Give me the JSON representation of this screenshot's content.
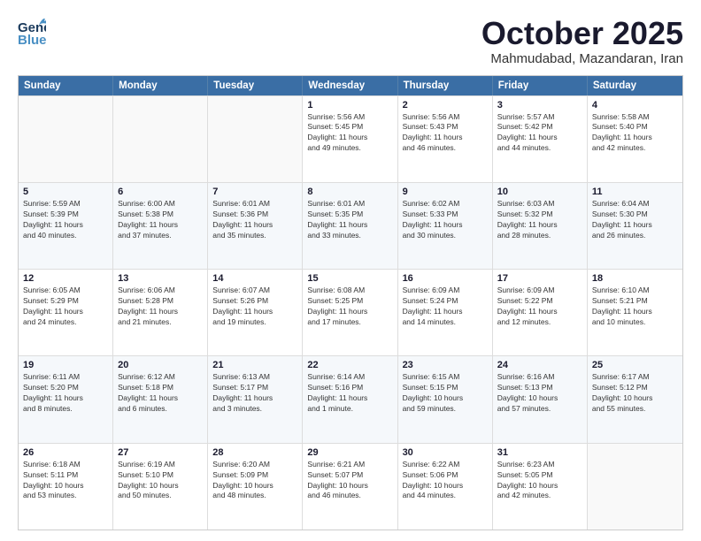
{
  "header": {
    "logo_general": "General",
    "logo_blue": "Blue",
    "month_title": "October 2025",
    "location": "Mahmudabad, Mazandaran, Iran"
  },
  "days_of_week": [
    "Sunday",
    "Monday",
    "Tuesday",
    "Wednesday",
    "Thursday",
    "Friday",
    "Saturday"
  ],
  "rows": [
    [
      {
        "day": "",
        "lines": []
      },
      {
        "day": "",
        "lines": []
      },
      {
        "day": "",
        "lines": []
      },
      {
        "day": "1",
        "lines": [
          "Sunrise: 5:56 AM",
          "Sunset: 5:45 PM",
          "Daylight: 11 hours",
          "and 49 minutes."
        ]
      },
      {
        "day": "2",
        "lines": [
          "Sunrise: 5:56 AM",
          "Sunset: 5:43 PM",
          "Daylight: 11 hours",
          "and 46 minutes."
        ]
      },
      {
        "day": "3",
        "lines": [
          "Sunrise: 5:57 AM",
          "Sunset: 5:42 PM",
          "Daylight: 11 hours",
          "and 44 minutes."
        ]
      },
      {
        "day": "4",
        "lines": [
          "Sunrise: 5:58 AM",
          "Sunset: 5:40 PM",
          "Daylight: 11 hours",
          "and 42 minutes."
        ]
      }
    ],
    [
      {
        "day": "5",
        "lines": [
          "Sunrise: 5:59 AM",
          "Sunset: 5:39 PM",
          "Daylight: 11 hours",
          "and 40 minutes."
        ]
      },
      {
        "day": "6",
        "lines": [
          "Sunrise: 6:00 AM",
          "Sunset: 5:38 PM",
          "Daylight: 11 hours",
          "and 37 minutes."
        ]
      },
      {
        "day": "7",
        "lines": [
          "Sunrise: 6:01 AM",
          "Sunset: 5:36 PM",
          "Daylight: 11 hours",
          "and 35 minutes."
        ]
      },
      {
        "day": "8",
        "lines": [
          "Sunrise: 6:01 AM",
          "Sunset: 5:35 PM",
          "Daylight: 11 hours",
          "and 33 minutes."
        ]
      },
      {
        "day": "9",
        "lines": [
          "Sunrise: 6:02 AM",
          "Sunset: 5:33 PM",
          "Daylight: 11 hours",
          "and 30 minutes."
        ]
      },
      {
        "day": "10",
        "lines": [
          "Sunrise: 6:03 AM",
          "Sunset: 5:32 PM",
          "Daylight: 11 hours",
          "and 28 minutes."
        ]
      },
      {
        "day": "11",
        "lines": [
          "Sunrise: 6:04 AM",
          "Sunset: 5:30 PM",
          "Daylight: 11 hours",
          "and 26 minutes."
        ]
      }
    ],
    [
      {
        "day": "12",
        "lines": [
          "Sunrise: 6:05 AM",
          "Sunset: 5:29 PM",
          "Daylight: 11 hours",
          "and 24 minutes."
        ]
      },
      {
        "day": "13",
        "lines": [
          "Sunrise: 6:06 AM",
          "Sunset: 5:28 PM",
          "Daylight: 11 hours",
          "and 21 minutes."
        ]
      },
      {
        "day": "14",
        "lines": [
          "Sunrise: 6:07 AM",
          "Sunset: 5:26 PM",
          "Daylight: 11 hours",
          "and 19 minutes."
        ]
      },
      {
        "day": "15",
        "lines": [
          "Sunrise: 6:08 AM",
          "Sunset: 5:25 PM",
          "Daylight: 11 hours",
          "and 17 minutes."
        ]
      },
      {
        "day": "16",
        "lines": [
          "Sunrise: 6:09 AM",
          "Sunset: 5:24 PM",
          "Daylight: 11 hours",
          "and 14 minutes."
        ]
      },
      {
        "day": "17",
        "lines": [
          "Sunrise: 6:09 AM",
          "Sunset: 5:22 PM",
          "Daylight: 11 hours",
          "and 12 minutes."
        ]
      },
      {
        "day": "18",
        "lines": [
          "Sunrise: 6:10 AM",
          "Sunset: 5:21 PM",
          "Daylight: 11 hours",
          "and 10 minutes."
        ]
      }
    ],
    [
      {
        "day": "19",
        "lines": [
          "Sunrise: 6:11 AM",
          "Sunset: 5:20 PM",
          "Daylight: 11 hours",
          "and 8 minutes."
        ]
      },
      {
        "day": "20",
        "lines": [
          "Sunrise: 6:12 AM",
          "Sunset: 5:18 PM",
          "Daylight: 11 hours",
          "and 6 minutes."
        ]
      },
      {
        "day": "21",
        "lines": [
          "Sunrise: 6:13 AM",
          "Sunset: 5:17 PM",
          "Daylight: 11 hours",
          "and 3 minutes."
        ]
      },
      {
        "day": "22",
        "lines": [
          "Sunrise: 6:14 AM",
          "Sunset: 5:16 PM",
          "Daylight: 11 hours",
          "and 1 minute."
        ]
      },
      {
        "day": "23",
        "lines": [
          "Sunrise: 6:15 AM",
          "Sunset: 5:15 PM",
          "Daylight: 10 hours",
          "and 59 minutes."
        ]
      },
      {
        "day": "24",
        "lines": [
          "Sunrise: 6:16 AM",
          "Sunset: 5:13 PM",
          "Daylight: 10 hours",
          "and 57 minutes."
        ]
      },
      {
        "day": "25",
        "lines": [
          "Sunrise: 6:17 AM",
          "Sunset: 5:12 PM",
          "Daylight: 10 hours",
          "and 55 minutes."
        ]
      }
    ],
    [
      {
        "day": "26",
        "lines": [
          "Sunrise: 6:18 AM",
          "Sunset: 5:11 PM",
          "Daylight: 10 hours",
          "and 53 minutes."
        ]
      },
      {
        "day": "27",
        "lines": [
          "Sunrise: 6:19 AM",
          "Sunset: 5:10 PM",
          "Daylight: 10 hours",
          "and 50 minutes."
        ]
      },
      {
        "day": "28",
        "lines": [
          "Sunrise: 6:20 AM",
          "Sunset: 5:09 PM",
          "Daylight: 10 hours",
          "and 48 minutes."
        ]
      },
      {
        "day": "29",
        "lines": [
          "Sunrise: 6:21 AM",
          "Sunset: 5:07 PM",
          "Daylight: 10 hours",
          "and 46 minutes."
        ]
      },
      {
        "day": "30",
        "lines": [
          "Sunrise: 6:22 AM",
          "Sunset: 5:06 PM",
          "Daylight: 10 hours",
          "and 44 minutes."
        ]
      },
      {
        "day": "31",
        "lines": [
          "Sunrise: 6:23 AM",
          "Sunset: 5:05 PM",
          "Daylight: 10 hours",
          "and 42 minutes."
        ]
      },
      {
        "day": "",
        "lines": []
      }
    ]
  ]
}
